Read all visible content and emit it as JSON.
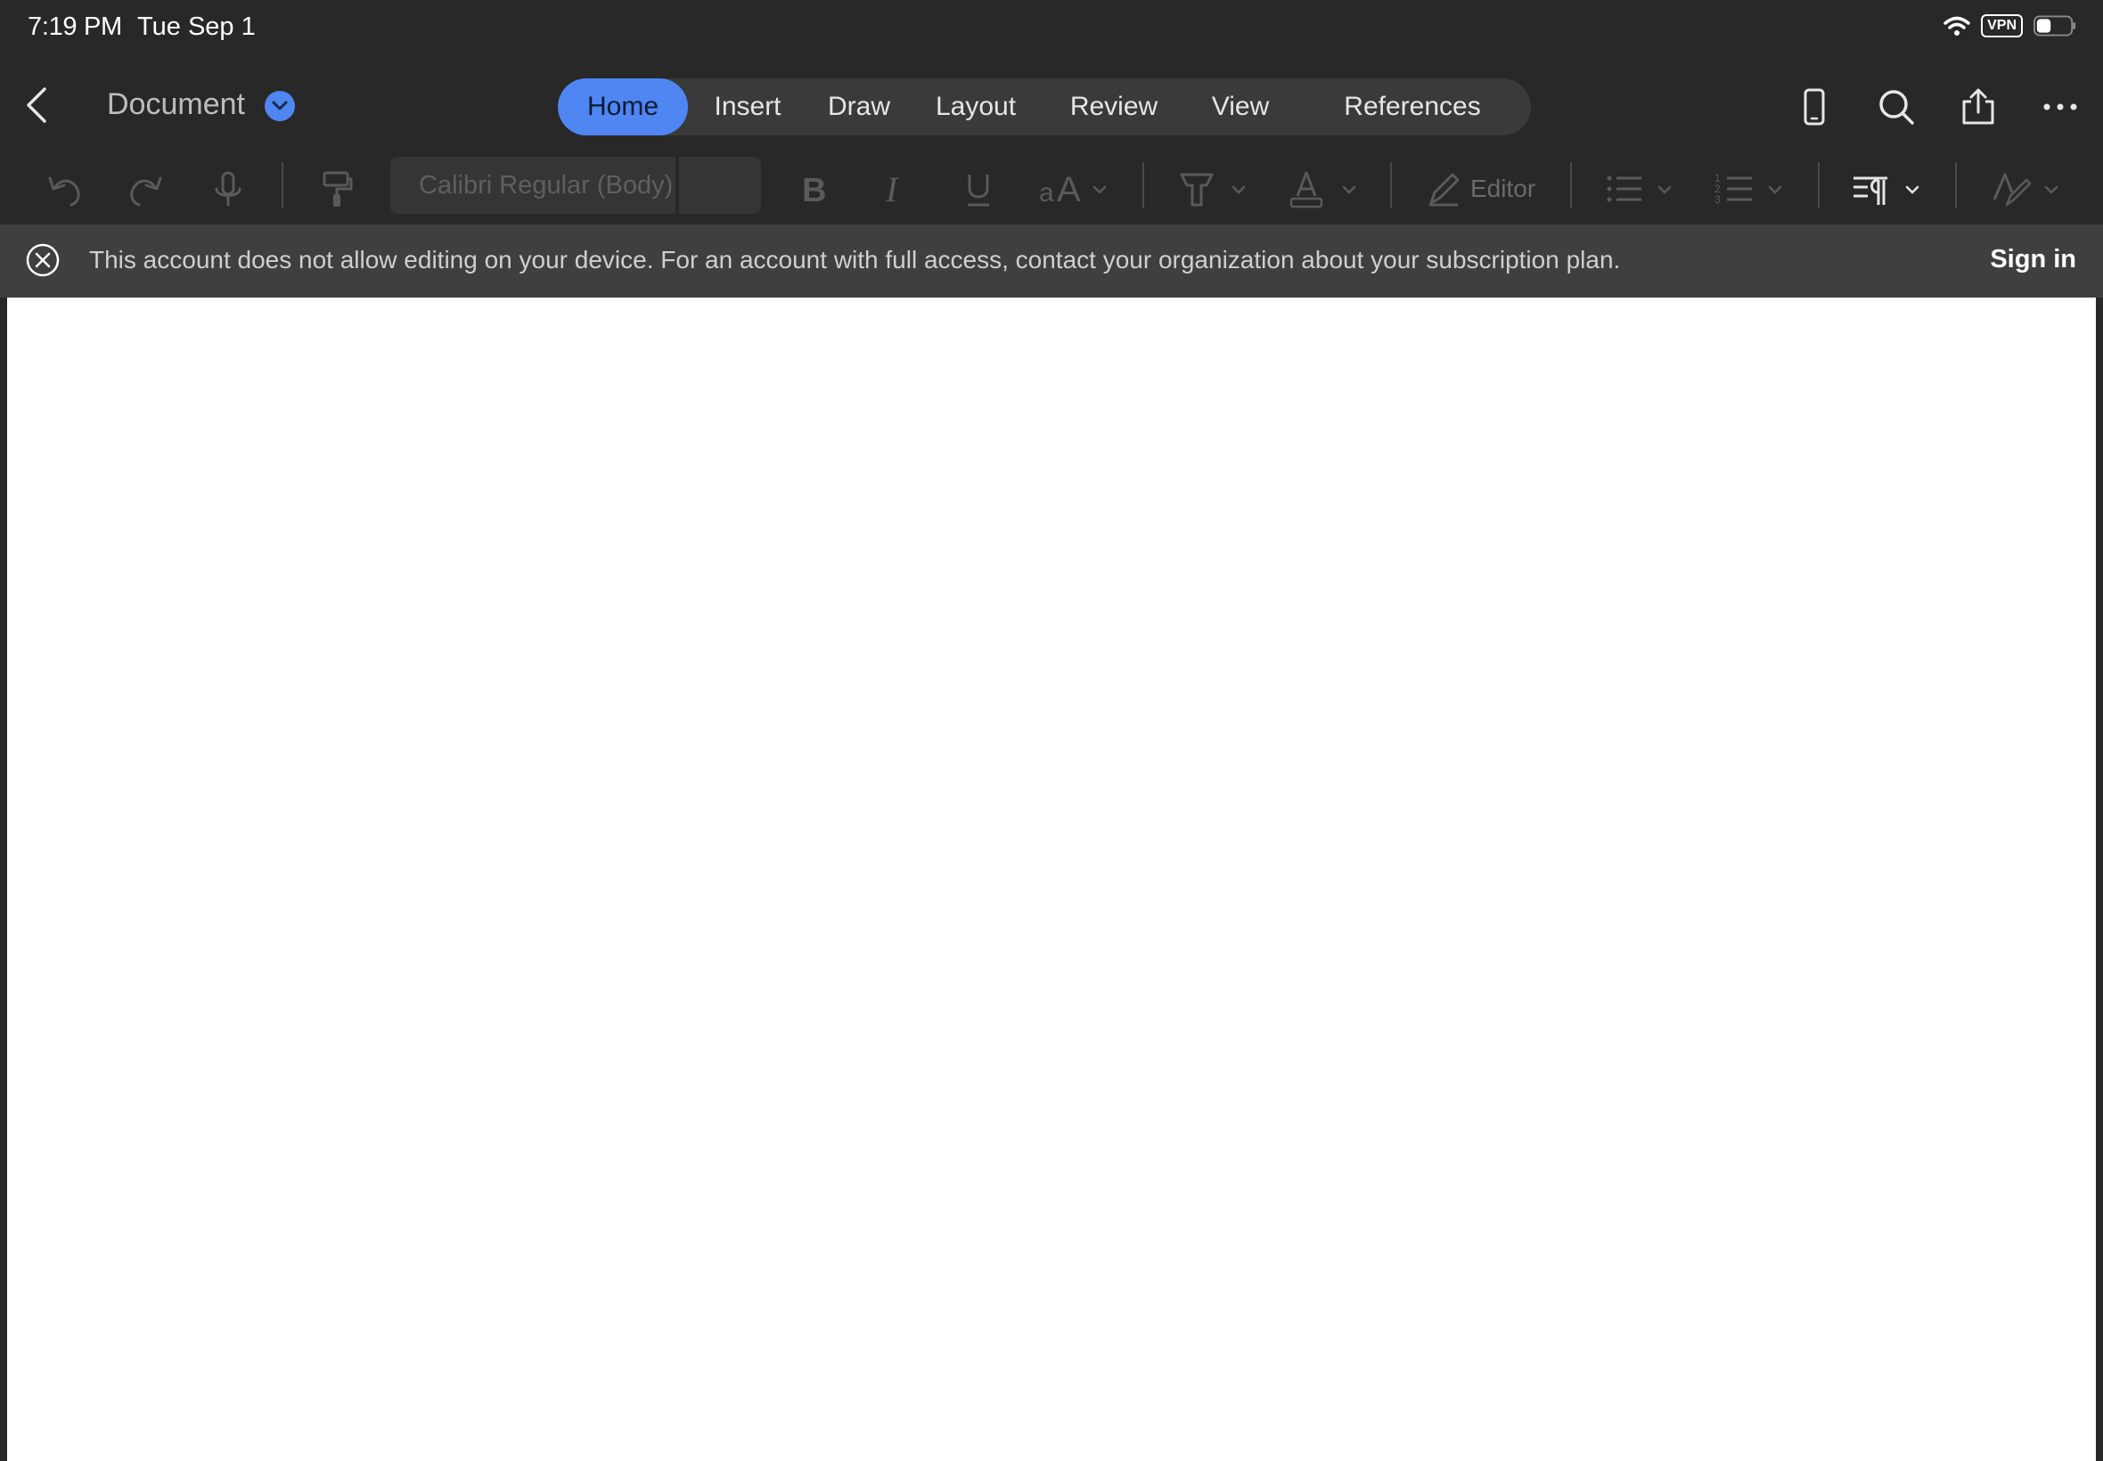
{
  "status_bar": {
    "time": "7:19 PM",
    "date": "Tue Sep 1",
    "vpn_label": "VPN",
    "icons": [
      "wifi-icon",
      "battery-icon"
    ]
  },
  "header": {
    "doc_title": "Document",
    "tabs": [
      {
        "label": "Home",
        "active": true
      },
      {
        "label": "Insert",
        "active": false
      },
      {
        "label": "Draw",
        "active": false
      },
      {
        "label": "Layout",
        "active": false
      },
      {
        "label": "Review",
        "active": false
      },
      {
        "label": "View",
        "active": false
      },
      {
        "label": "References",
        "active": false
      }
    ],
    "right_icons": [
      "phone-view-icon",
      "search-icon",
      "share-icon",
      "more-icon"
    ]
  },
  "ribbon": {
    "font_name": "Calibri Regular (Body)",
    "font_size": "",
    "editor_label": "Editor",
    "icons": [
      "undo-icon",
      "redo-icon",
      "dictate-icon",
      "format-painter-icon",
      "bold-icon",
      "italic-icon",
      "underline-icon",
      "text-size-icon",
      "highlighter-icon",
      "font-color-icon",
      "editor-icon",
      "bullet-list-icon",
      "numbered-list-icon",
      "paragraph-icon",
      "styles-icon"
    ]
  },
  "banner": {
    "message": "This account does not allow editing on your device. For an account with full access, contact your organization about your subscription plan.",
    "sign_in_label": "Sign in"
  },
  "colors": {
    "accent": "#4f86f2",
    "chrome_bg": "#282828",
    "banner_bg": "#3f3f3f",
    "page_bg": "#ffffff"
  }
}
